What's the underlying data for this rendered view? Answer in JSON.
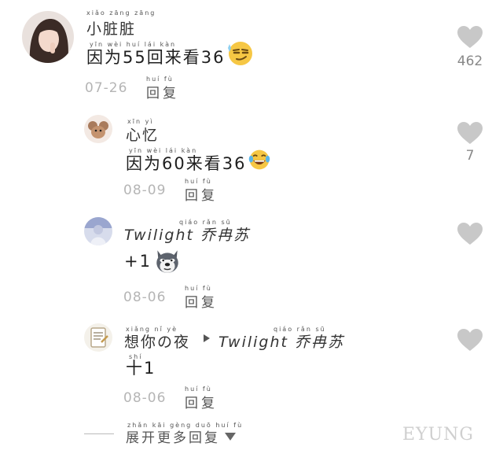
{
  "comments": [
    {
      "author": "小脏脏",
      "author_pinyin": "xiǎo zāng zāng",
      "text": "因为55回来看36",
      "text_pinyin": "yīn wèi      huí lái kàn",
      "emoji": "smirk-face-emoji",
      "date": "07-26",
      "reply_label": "回复",
      "reply_pinyin": "huí  fù",
      "likes": "462"
    },
    {
      "author": "心忆",
      "author_pinyin": "xīn  yì",
      "text": "因为60来看36",
      "text_pinyin": "yīn wèi     lái kàn",
      "emoji": "laughing-tears-emoji",
      "date": "08-09",
      "reply_label": "回复",
      "reply_pinyin": "huí  fù",
      "likes": "7"
    },
    {
      "author": "Twilight 乔冉苏",
      "author_pinyin": "qiáo rǎn sū",
      "text": "+1",
      "emoji": "husky-dog-emoji",
      "date": "08-06",
      "reply_label": "回复",
      "reply_pinyin": "huí  fù"
    },
    {
      "author": "想你の夜",
      "author_pinyin": "xiǎng nǐ    yè",
      "reply_to": "Twilight 乔冉苏",
      "reply_to_pinyin": "qiáo rǎn sū",
      "text": "十1",
      "text_pinyin": "shí",
      "date": "08-06",
      "reply_label": "回复",
      "reply_pinyin": "huí  fù"
    }
  ],
  "more_replies": {
    "label": "展开更多回复",
    "pinyin": "zhǎn kāi gèng duō huí fù"
  },
  "watermark": "EYUNG",
  "colors": {
    "heart": "#c8c8c8",
    "date": "#b5b5b5"
  }
}
